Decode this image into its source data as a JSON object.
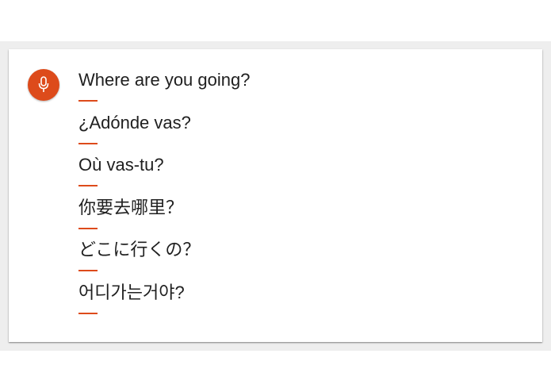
{
  "colors": {
    "accent": "#dd4b1b",
    "text": "#202020",
    "backdrop": "#eeeeee",
    "card": "#ffffff"
  },
  "mic": {
    "icon": "microphone-icon"
  },
  "phrases": [
    {
      "text": "Where are you going?"
    },
    {
      "text": "¿Adónde vas?"
    },
    {
      "text": "Où vas-tu?"
    },
    {
      "text": "你要去哪里？"
    },
    {
      "text": "どこに行くの？"
    },
    {
      "text": "어디가는거야?"
    }
  ]
}
